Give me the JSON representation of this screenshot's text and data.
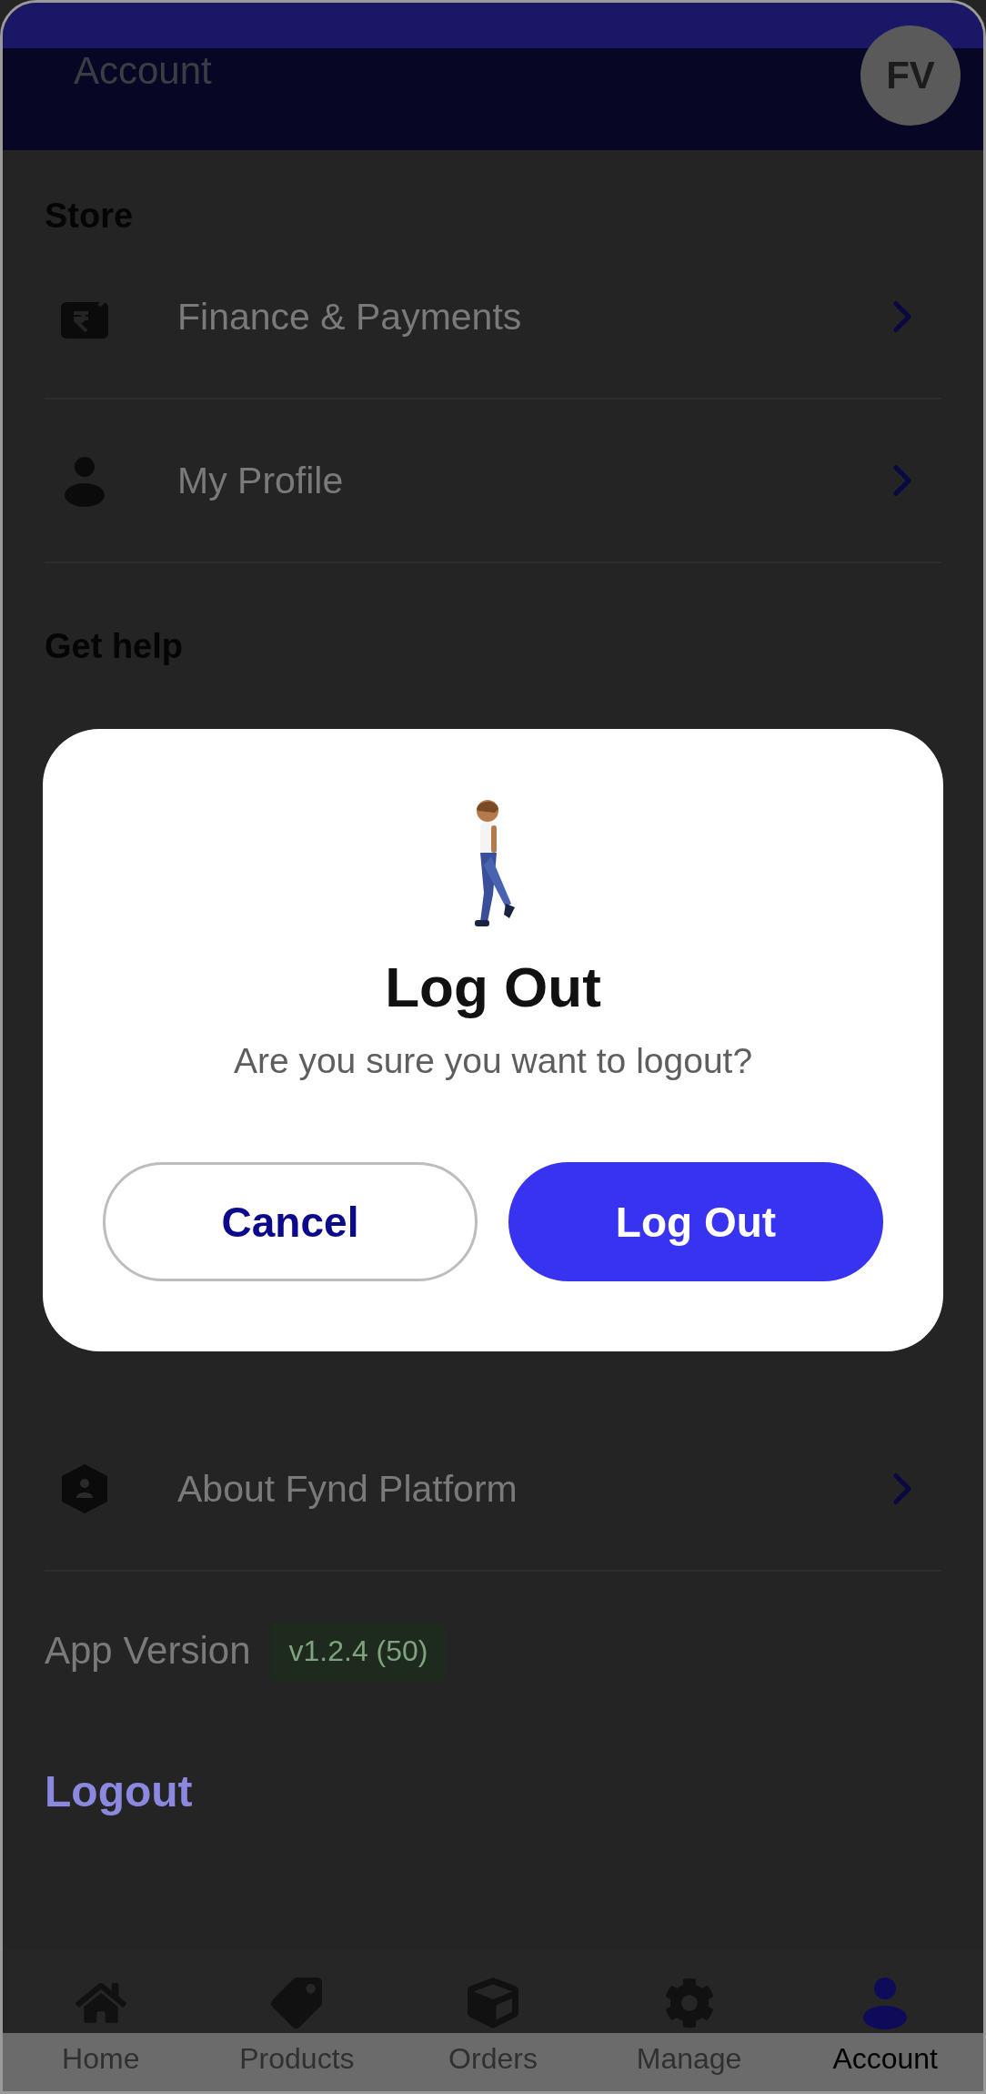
{
  "header": {
    "title": "Account",
    "avatar": "FV"
  },
  "store": {
    "heading": "Store",
    "items": [
      {
        "label": "Finance & Payments",
        "kind": "finance"
      },
      {
        "label": "My Profile",
        "kind": "profile"
      }
    ]
  },
  "get_help": {
    "heading": "Get help"
  },
  "more_items": [
    {
      "label": "About Fynd Platform",
      "kind": "about"
    }
  ],
  "app_version": {
    "label": "App Version",
    "value": "v1.2.4 (50)"
  },
  "logout_link": "Logout",
  "tabs": [
    {
      "label": "Home",
      "kind": "home",
      "selected": false
    },
    {
      "label": "Products",
      "kind": "products",
      "selected": false
    },
    {
      "label": "Orders",
      "kind": "orders",
      "selected": false
    },
    {
      "label": "Manage",
      "kind": "manage",
      "selected": false
    },
    {
      "label": "Account",
      "kind": "account",
      "selected": true
    }
  ],
  "dialog": {
    "title": "Log Out",
    "message": "Are you sure you want to logout?",
    "buttons": [
      {
        "label": "Cancel",
        "kind": "secondary"
      },
      {
        "label": "Log Out",
        "kind": "primary"
      }
    ]
  }
}
